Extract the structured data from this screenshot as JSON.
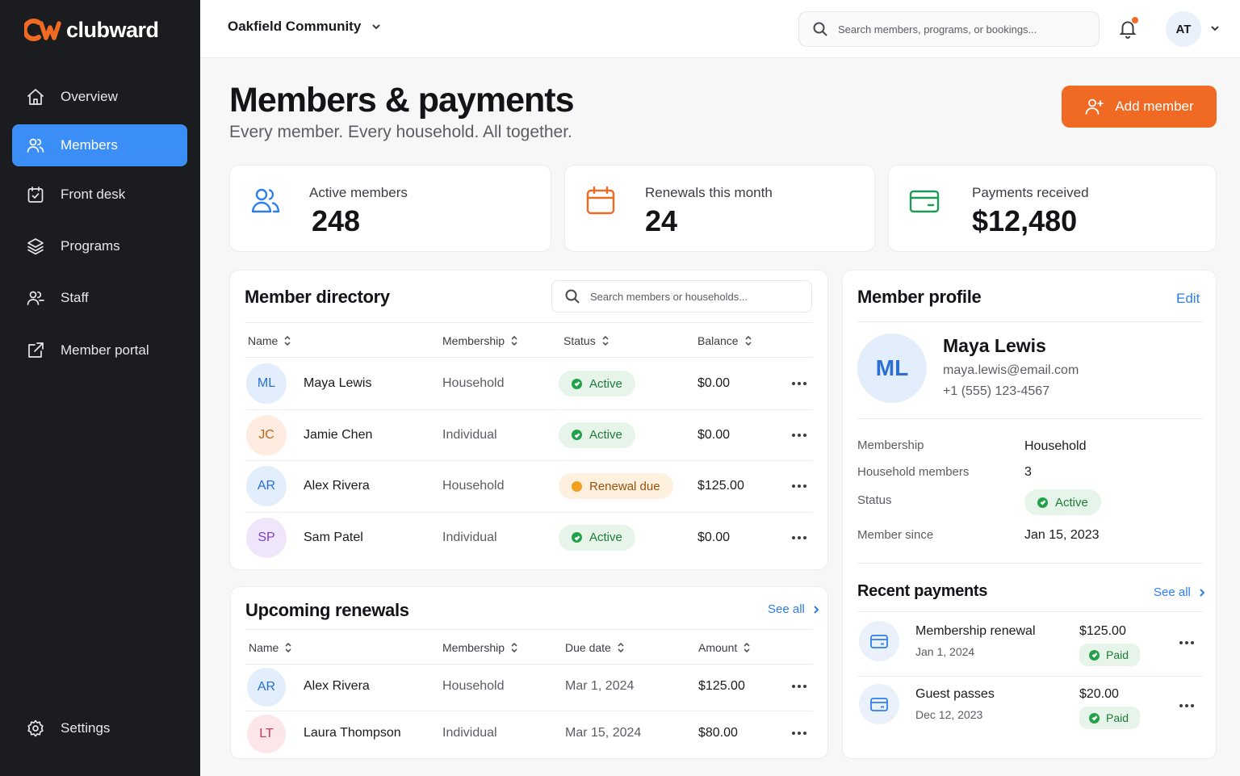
{
  "brand": {
    "name": "clubward",
    "accent": "#f06a24"
  },
  "sidebar": {
    "items": [
      {
        "label": "Overview",
        "icon": "home-icon"
      },
      {
        "label": "Members",
        "icon": "users-icon",
        "active": true
      },
      {
        "label": "Front desk",
        "icon": "calendar-check-icon"
      },
      {
        "label": "Programs",
        "icon": "layers-icon"
      },
      {
        "label": "Staff",
        "icon": "staff-icon"
      },
      {
        "label": "Member portal",
        "icon": "external-link-icon"
      }
    ],
    "settings": {
      "label": "Settings",
      "icon": "gear-icon"
    }
  },
  "topbar": {
    "org": "Oakfield Community",
    "search_placeholder": "Search members, programs, or bookings...",
    "user_initials": "AT",
    "has_notification": true
  },
  "header": {
    "title": "Members & payments",
    "subtitle": "Every member. Every household. All together.",
    "add_label": "Add member"
  },
  "stats": [
    {
      "label": "Active members",
      "value": "248",
      "color": "#2d7ef0"
    },
    {
      "label": "Renewals this month",
      "value": "24",
      "color": "#f06a24"
    },
    {
      "label": "Payments received",
      "value": "$12,480",
      "color": "#1f9a57"
    }
  ],
  "directory": {
    "title": "Member directory",
    "search_placeholder": "Search members or households...",
    "columns": [
      "Name",
      "Membership",
      "Status",
      "Balance"
    ],
    "rows": [
      {
        "initials": "ML",
        "name": "Maya Lewis",
        "membership": "Household",
        "status": "Active",
        "balance": "$0.00",
        "bg": "#e3eefc",
        "fg": "#2a6fd1"
      },
      {
        "initials": "JC",
        "name": "Jamie Chen",
        "membership": "Individual",
        "status": "Active",
        "balance": "$0.00",
        "bg": "#fdecdf",
        "fg": "#c0661d"
      },
      {
        "initials": "AR",
        "name": "Alex Rivera",
        "membership": "Household",
        "status": "Renewal due",
        "balance": "$125.00",
        "bg": "#e3eefc",
        "fg": "#2a6fd1"
      },
      {
        "initials": "SP",
        "name": "Sam Patel",
        "membership": "Individual",
        "status": "Active",
        "balance": "$0.00",
        "bg": "#efe6fb",
        "fg": "#7b3fc4"
      }
    ]
  },
  "renewals": {
    "title": "Upcoming renewals",
    "see_all": "See all",
    "columns": [
      "Name",
      "Membership",
      "Due date",
      "Amount"
    ],
    "rows": [
      {
        "initials": "AR",
        "name": "Alex Rivera",
        "membership": "Household",
        "due": "Mar 1, 2024",
        "amount": "$125.00",
        "bg": "#e3eefc",
        "fg": "#2a6fd1"
      },
      {
        "initials": "LT",
        "name": "Laura Thompson",
        "membership": "Individual",
        "due": "Mar 15, 2024",
        "amount": "$80.00",
        "bg": "#fce6ea",
        "fg": "#c83a55"
      }
    ]
  },
  "profile": {
    "title": "Member profile",
    "edit_label": "Edit",
    "initials": "ML",
    "name": "Maya Lewis",
    "email": "maya.lewis@email.com",
    "phone": "+1 (555) 123-4567",
    "fields": [
      {
        "key": "Membership",
        "value": "Household"
      },
      {
        "key": "Household members",
        "value": "3"
      },
      {
        "key": "Status",
        "value": "Active"
      },
      {
        "key": "Member since",
        "value": "Jan 15, 2023"
      }
    ]
  },
  "payments": {
    "title": "Recent payments",
    "see_all": "See all",
    "items": [
      {
        "title": "Membership renewal",
        "date": "Jan 1, 2024",
        "amount": "$125.00",
        "status": "Paid"
      },
      {
        "title": "Guest passes",
        "date": "Dec 12, 2023",
        "amount": "$20.00",
        "status": "Paid"
      }
    ]
  }
}
